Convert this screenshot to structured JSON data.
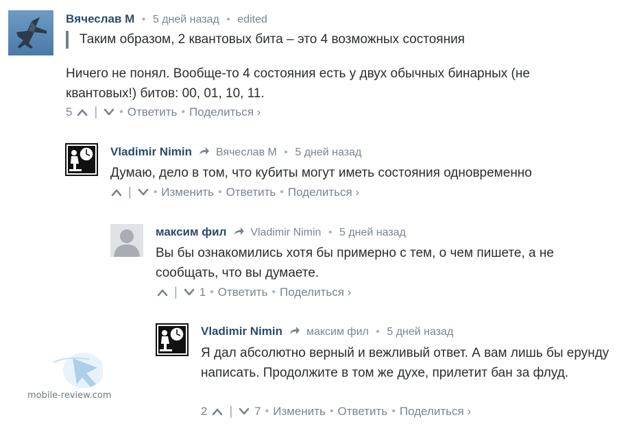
{
  "comments": [
    {
      "author": "Вячеслав М",
      "time": "5 дней назад",
      "edited": "edited",
      "quote": "Таким образом, 2 квантовых бита – это 4 возможных состояния",
      "body": "Ничего не понял. Вообще-то 4 состояния есть у двух обычных бинарных (не квантовых!) битов: 00, 01, 10, 11.",
      "upvotes": "5",
      "actions": {
        "reply": "Ответить",
        "share": "Поделиться ›"
      }
    },
    {
      "author": "Vladimir Nimin",
      "reply_to": "Вячеслав М",
      "time": "5 дней назад",
      "body": "Думаю, дело в том, что кубиты могут иметь состояния одновременно",
      "actions": {
        "edit": "Изменить",
        "reply": "Ответить",
        "share": "Поделиться ›"
      }
    },
    {
      "author": "максим фил",
      "reply_to": "Vladimir Nimin",
      "time": "5 дней назад",
      "body": "Вы бы ознакомились хотя бы примерно с тем, о чем пишете, а не сообщать, что вы думаете.",
      "downvotes": "1",
      "actions": {
        "reply": "Ответить",
        "share": "Поделиться ›"
      }
    },
    {
      "author": "Vladimir Nimin",
      "reply_to": "максим фил",
      "time": "5 дней назад",
      "body": "Я дал абсолютно верный и вежливый ответ. А вам лишь бы ерунду написать. Продолжите в том же духе, прилетит бан за флуд.",
      "upvotes": "2",
      "downvotes": "7",
      "actions": {
        "edit": "Изменить",
        "reply": "Ответить",
        "share": "Поделиться ›"
      }
    }
  ],
  "watermark": {
    "text": "mobile-review.com"
  },
  "icons": [
    "jet-avatar",
    "clock-avatar",
    "default-avatar",
    "reply-arrow-icon",
    "upvote-icon",
    "downvote-icon"
  ]
}
